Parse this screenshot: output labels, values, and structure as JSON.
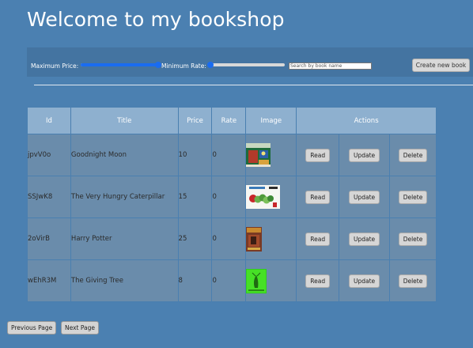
{
  "header": {
    "title": "Welcome to my bookshop"
  },
  "filters": {
    "max_price_label": "Maximum Price:",
    "max_price_value": 1.0,
    "min_rate_label": "Minimum Rate:",
    "min_rate_value": 0.0,
    "search_placeholder": "Search by book name",
    "create_label": "Create new book"
  },
  "table": {
    "columns": [
      "Id",
      "Title",
      "Price",
      "Rate",
      "Image",
      "Actions"
    ],
    "rows": [
      {
        "id": "jpvV0o",
        "title": "Goodnight Moon",
        "price": "10",
        "rate": "0",
        "image": "goodnight-moon-cover"
      },
      {
        "id": "SSJwK8",
        "title": "The Very Hungry Caterpillar",
        "price": "15",
        "rate": "0",
        "image": "hungry-caterpillar-cover"
      },
      {
        "id": "2oVirB",
        "title": "Harry Potter",
        "price": "25",
        "rate": "0",
        "image": "harry-potter-cover"
      },
      {
        "id": "wEhR3M",
        "title": "The Giving Tree",
        "price": "8",
        "rate": "0",
        "image": "giving-tree-cover"
      }
    ],
    "actions": {
      "read": "Read",
      "update": "Update",
      "delete": "Delete"
    }
  },
  "pager": {
    "prev_label": "Previous Page",
    "next_label": "Next Page"
  },
  "colors": {
    "background": "#4b80b1",
    "toolbar": "#4474a1",
    "header_cell": "#8eb0cf",
    "body_cell": "#6a8cab",
    "slider_accent": "#1a6cf0"
  }
}
